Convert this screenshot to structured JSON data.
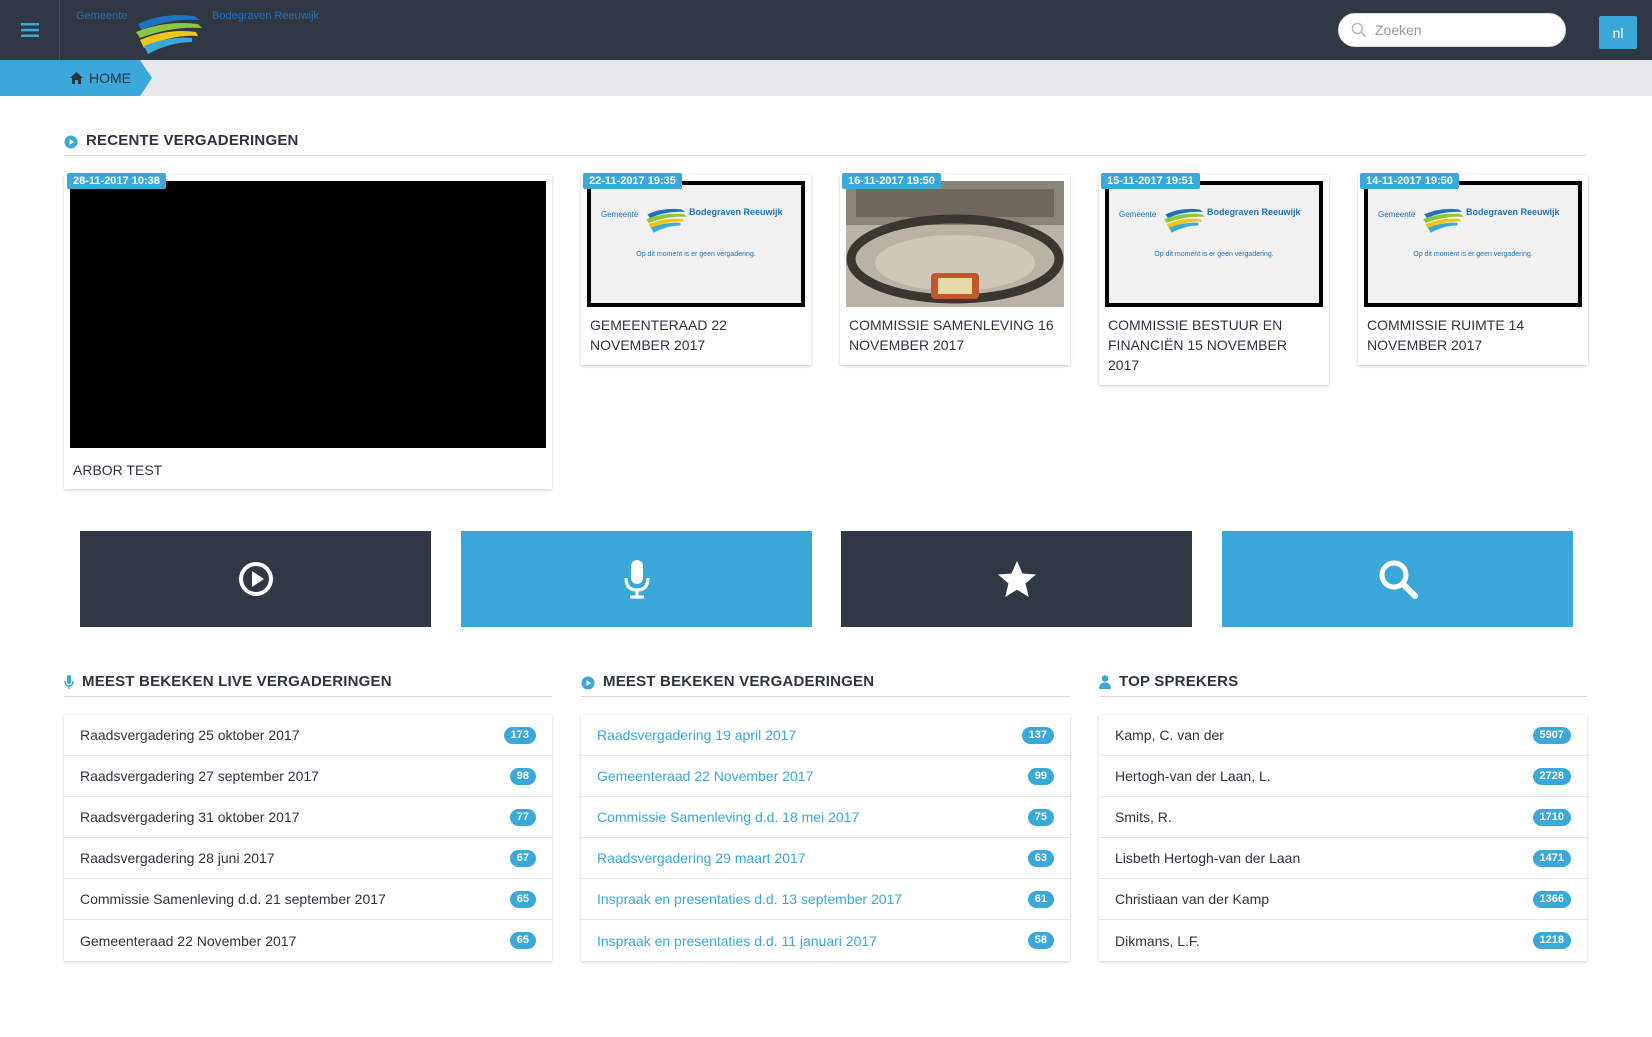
{
  "header": {
    "logo": {
      "left_text": "Gemeente",
      "right_text": "Bodegraven Reeuwijk"
    },
    "search": {
      "placeholder": "Zoeken",
      "value": ""
    },
    "lang_label": "nl"
  },
  "breadcrumb": {
    "home_label": "HOME"
  },
  "recent": {
    "title": "RECENTE VERGADERINGEN",
    "featured": {
      "date": "28-11-2017 10:38",
      "title": "ARBOR TEST"
    },
    "cards": [
      {
        "date": "22-11-2017 19:35",
        "title": "GEMEENTERAAD 22 NOVEMBER 2017",
        "thumb": "placeholder-screen"
      },
      {
        "date": "16-11-2017 19:50",
        "title": "COMMISSIE SAMENLEVING 16 NOVEMBER 2017",
        "thumb": "council-room-photo"
      },
      {
        "date": "15-11-2017 19:51",
        "title": "COMMISSIE BESTUUR EN FINANCIËN 15 NOVEMBER 2017",
        "thumb": "placeholder-screen"
      },
      {
        "date": "14-11-2017 19:50",
        "title": "COMMISSIE RUIMTE 14 NOVEMBER 2017",
        "thumb": "placeholder-screen"
      }
    ],
    "placeholder_screen": {
      "left_text": "Gemeente",
      "right_text": "Bodegraven Reeuwijk",
      "message": "Op dit moment is er geen vergadering."
    }
  },
  "tiles": [
    {
      "icon": "play-circle-icon",
      "color": "#303844"
    },
    {
      "icon": "microphone-icon",
      "color": "#3aa8d8"
    },
    {
      "icon": "star-icon",
      "color": "#303844"
    },
    {
      "icon": "search-icon",
      "color": "#3aa8d8"
    }
  ],
  "live": {
    "title": "MEEST BEKEKEN LIVE VERGADERINGEN",
    "items": [
      {
        "label": "Raadsvergadering 25 oktober 2017",
        "count": "173"
      },
      {
        "label": "Raadsvergadering 27 september 2017",
        "count": "98"
      },
      {
        "label": "Raadsvergadering 31 oktober 2017",
        "count": "77"
      },
      {
        "label": "Raadsvergadering 28 juni 2017",
        "count": "67"
      },
      {
        "label": "Commissie Samenleving d.d. 21 september 2017",
        "count": "65"
      },
      {
        "label": "Gemeenteraad 22 November 2017",
        "count": "65"
      }
    ]
  },
  "viewed": {
    "title": "MEEST BEKEKEN VERGADERINGEN",
    "items": [
      {
        "label": "Raadsvergadering 19 april 2017",
        "count": "137"
      },
      {
        "label": "Gemeenteraad 22 November 2017",
        "count": "99"
      },
      {
        "label": "Commissie Samenleving d.d. 18 mei 2017",
        "count": "75"
      },
      {
        "label": "Raadsvergadering 29 maart 2017",
        "count": "63"
      },
      {
        "label": "Inspraak en presentaties d.d. 13 september 2017",
        "count": "61"
      },
      {
        "label": "Inspraak en presentaties d.d. 11 januari 2017",
        "count": "58"
      }
    ]
  },
  "speakers": {
    "title": "TOP SPREKERS",
    "items": [
      {
        "label": "Kamp, C. van der",
        "count": "5907"
      },
      {
        "label": "Hertogh-van der Laan, L.",
        "count": "2728"
      },
      {
        "label": "Smits, R.",
        "count": "1710"
      },
      {
        "label": "Lisbeth Hertogh-van der Laan",
        "count": "1471"
      },
      {
        "label": "Christiaan van der Kamp",
        "count": "1366"
      },
      {
        "label": "Dikmans, L.F.",
        "count": "1218"
      }
    ]
  },
  "colors": {
    "dark": "#303844",
    "accent": "#3aa8d8",
    "crumb_bg": "#e7e8ea"
  }
}
